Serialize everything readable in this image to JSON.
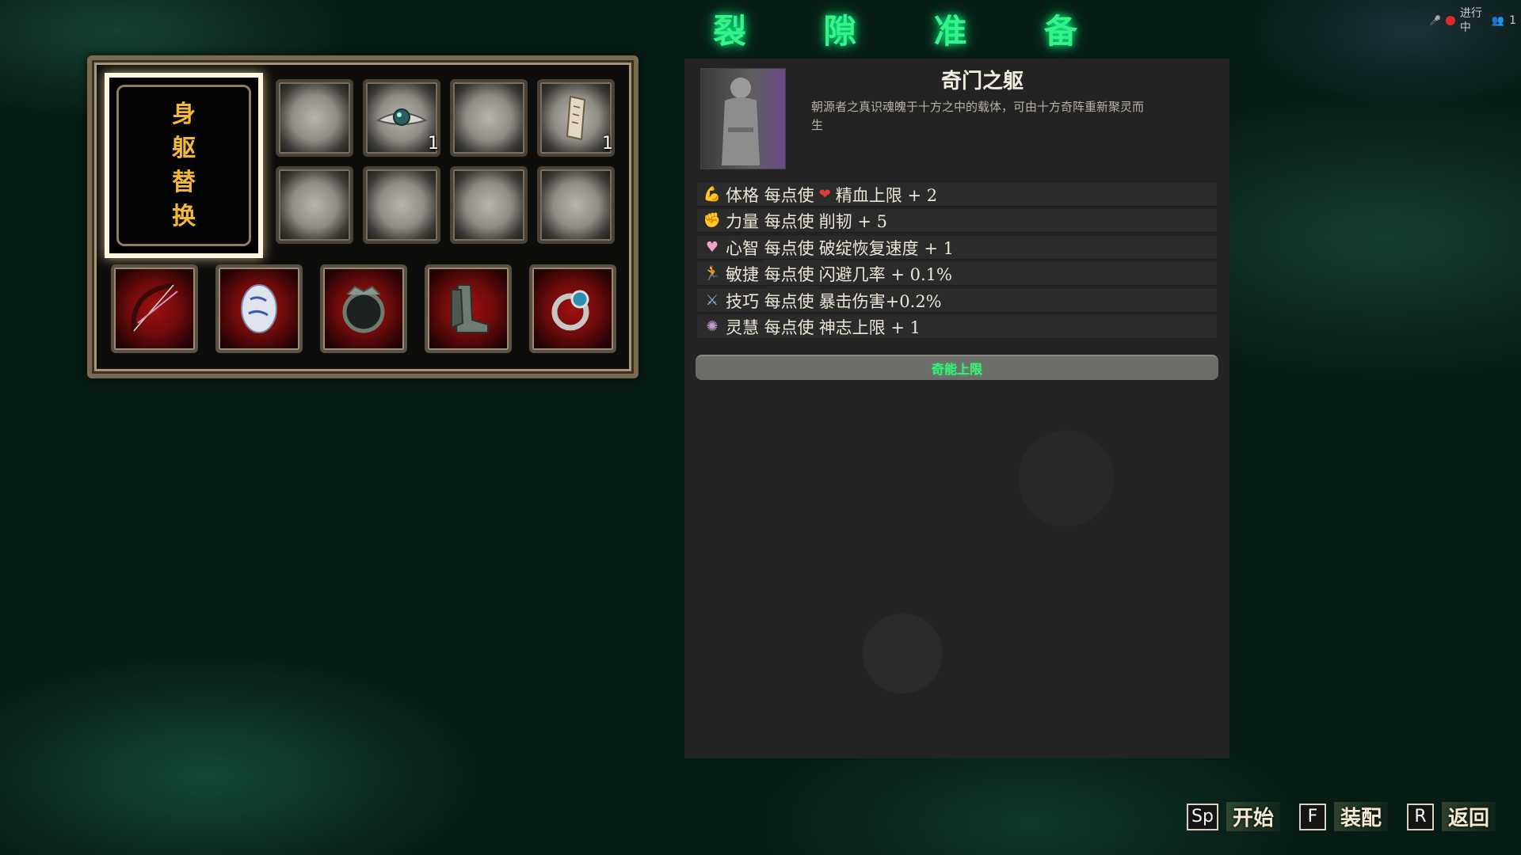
{
  "header": {
    "title_chars": [
      "裂",
      "隙",
      "准",
      "备"
    ]
  },
  "status": {
    "text": "进行中",
    "player_count": "1",
    "mic_icon": "mic-off-icon",
    "people_icon": "people-icon"
  },
  "inventory": {
    "body_replace_chars": [
      "身",
      "躯",
      "替",
      "换"
    ],
    "slots": [
      {
        "item": "empty",
        "count": ""
      },
      {
        "item": "gem-icon",
        "count": "1"
      },
      {
        "item": "empty",
        "count": ""
      },
      {
        "item": "scroll-icon",
        "count": "1"
      },
      {
        "item": "empty",
        "count": ""
      },
      {
        "item": "empty",
        "count": ""
      },
      {
        "item": "empty",
        "count": ""
      },
      {
        "item": "empty",
        "count": ""
      }
    ],
    "equipment": [
      "bow-icon",
      "stone-charm-icon",
      "armor-icon",
      "boots-icon",
      "ring-icon"
    ]
  },
  "detail": {
    "name": "奇门之躯",
    "description": "朝源者之真识魂魄于十方之中的载体，可由十方奇阵重新聚灵而生",
    "stats": [
      {
        "label": "体格 每点使 ",
        "extra_icon": "heart-icon",
        "effect": "精血上限 + 2",
        "icon": "muscle-icon"
      },
      {
        "label": "力量 每点使 ",
        "extra_icon": "",
        "effect": "削韧 + 5",
        "icon": "fist-icon"
      },
      {
        "label": "心智 每点使 ",
        "extra_icon": "",
        "effect": "破绽恢复速度 + 1",
        "icon": "heart-icon"
      },
      {
        "label": "敏捷 每点使 ",
        "extra_icon": "",
        "effect": "闪避几率 + 0.1%",
        "icon": "runner-icon"
      },
      {
        "label": "技巧 每点使 ",
        "extra_icon": "",
        "effect": "暴击伤害+0.2%",
        "icon": "crossed-swords-icon"
      },
      {
        "label": "灵慧 每点使 ",
        "extra_icon": "",
        "effect": "神志上限 + 1",
        "icon": "brain-icon"
      }
    ],
    "energy_button": "奇能上限"
  },
  "controls": [
    {
      "key": "Sp",
      "label": "开始"
    },
    {
      "key": "F",
      "label": "装配"
    },
    {
      "key": "R",
      "label": "返回"
    }
  ],
  "colors": {
    "title_green": "#39f08a",
    "gold": "#f1b93a",
    "energy_green": "#3ef07a",
    "panel_bg": "#232323"
  }
}
